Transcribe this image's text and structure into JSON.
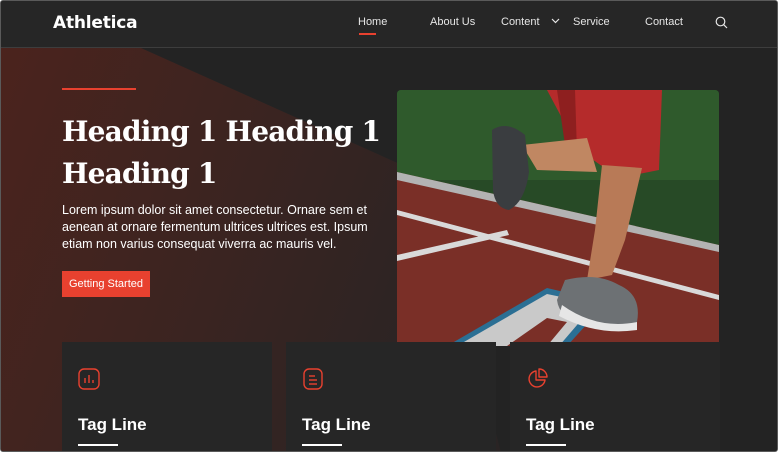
{
  "brand": {
    "name": "Athletica"
  },
  "nav": {
    "items": [
      {
        "label": "Home",
        "active": true
      },
      {
        "label": "About Us",
        "active": false
      },
      {
        "label": "Content",
        "active": false,
        "has_dropdown": true
      },
      {
        "label": "Service",
        "active": false
      },
      {
        "label": "Contact",
        "active": false
      }
    ],
    "search_icon": "search-icon"
  },
  "hero": {
    "heading_line1": "Heading 1 Heading 1",
    "heading_line2": "Heading 1",
    "body": "Lorem ipsum dolor sit amet consectetur. Ornare sem et aenean at ornare fermentum ultrices ultrices est. Ipsum etiam non varius consequat viverra ac mauris vel.",
    "cta_label": "Getting Started",
    "image_subject": "runner-on-track"
  },
  "cards": [
    {
      "icon": "bar-chart-icon",
      "title": "Tag Line"
    },
    {
      "icon": "document-icon",
      "title": "Tag Line"
    },
    {
      "icon": "pie-chart-icon",
      "title": "Tag Line"
    }
  ],
  "colors": {
    "accent": "#e8412f",
    "background": "#242424",
    "hero_gradient": "#4a231e",
    "text": "#ffffff"
  }
}
